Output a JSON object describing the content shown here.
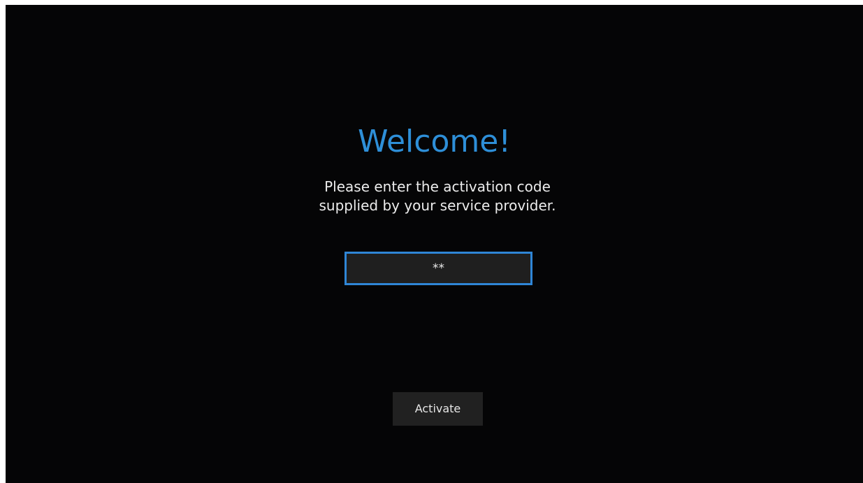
{
  "welcome": {
    "title": "Welcome!",
    "instructions_line1": "Please enter the activation code",
    "instructions_line2": "supplied by your service provider."
  },
  "activation_code": {
    "value": "**"
  },
  "actions": {
    "activate_label": "Activate"
  },
  "colors": {
    "background": "#050506",
    "accent": "#2e8fd8",
    "field_background": "#1f1f1f",
    "button_background": "#212121",
    "text": "#ececec"
  }
}
